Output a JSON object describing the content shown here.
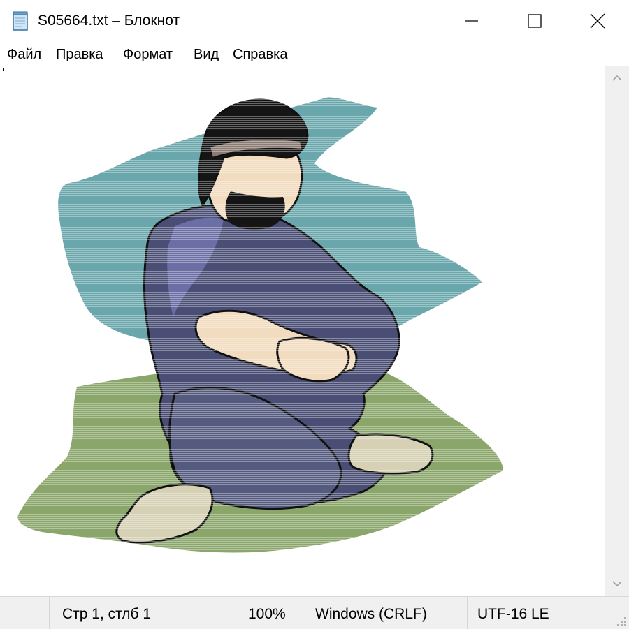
{
  "window": {
    "title": "S05664.txt – Блокнот",
    "icon": "notepad-icon",
    "controls": [
      "minimize-icon",
      "maximize-icon",
      "close-icon"
    ]
  },
  "menu": {
    "items": [
      "Файл",
      "Правка",
      "Формат",
      "Вид",
      "Справка"
    ]
  },
  "editor": {
    "content_kind": "ascii-art illustration",
    "art_colors": {
      "sky_patch": "#6aa7ac",
      "grass_patch": "#8aa66a",
      "robe": "#4a4e74",
      "robe_light": "#6b6fa6",
      "skin": "#f2dcc0",
      "hair": "#151515",
      "headband": "#8c7b72",
      "shoe": "#d6d0b4",
      "outline": "#101010"
    }
  },
  "scrollbar": {
    "up_icon": "chevron-up-icon",
    "down_icon": "chevron-down-icon"
  },
  "statusbar": {
    "position": "Стр 1, стлб 1",
    "zoom": "100%",
    "line_ending": "Windows (CRLF)",
    "encoding": "UTF-16 LE"
  }
}
